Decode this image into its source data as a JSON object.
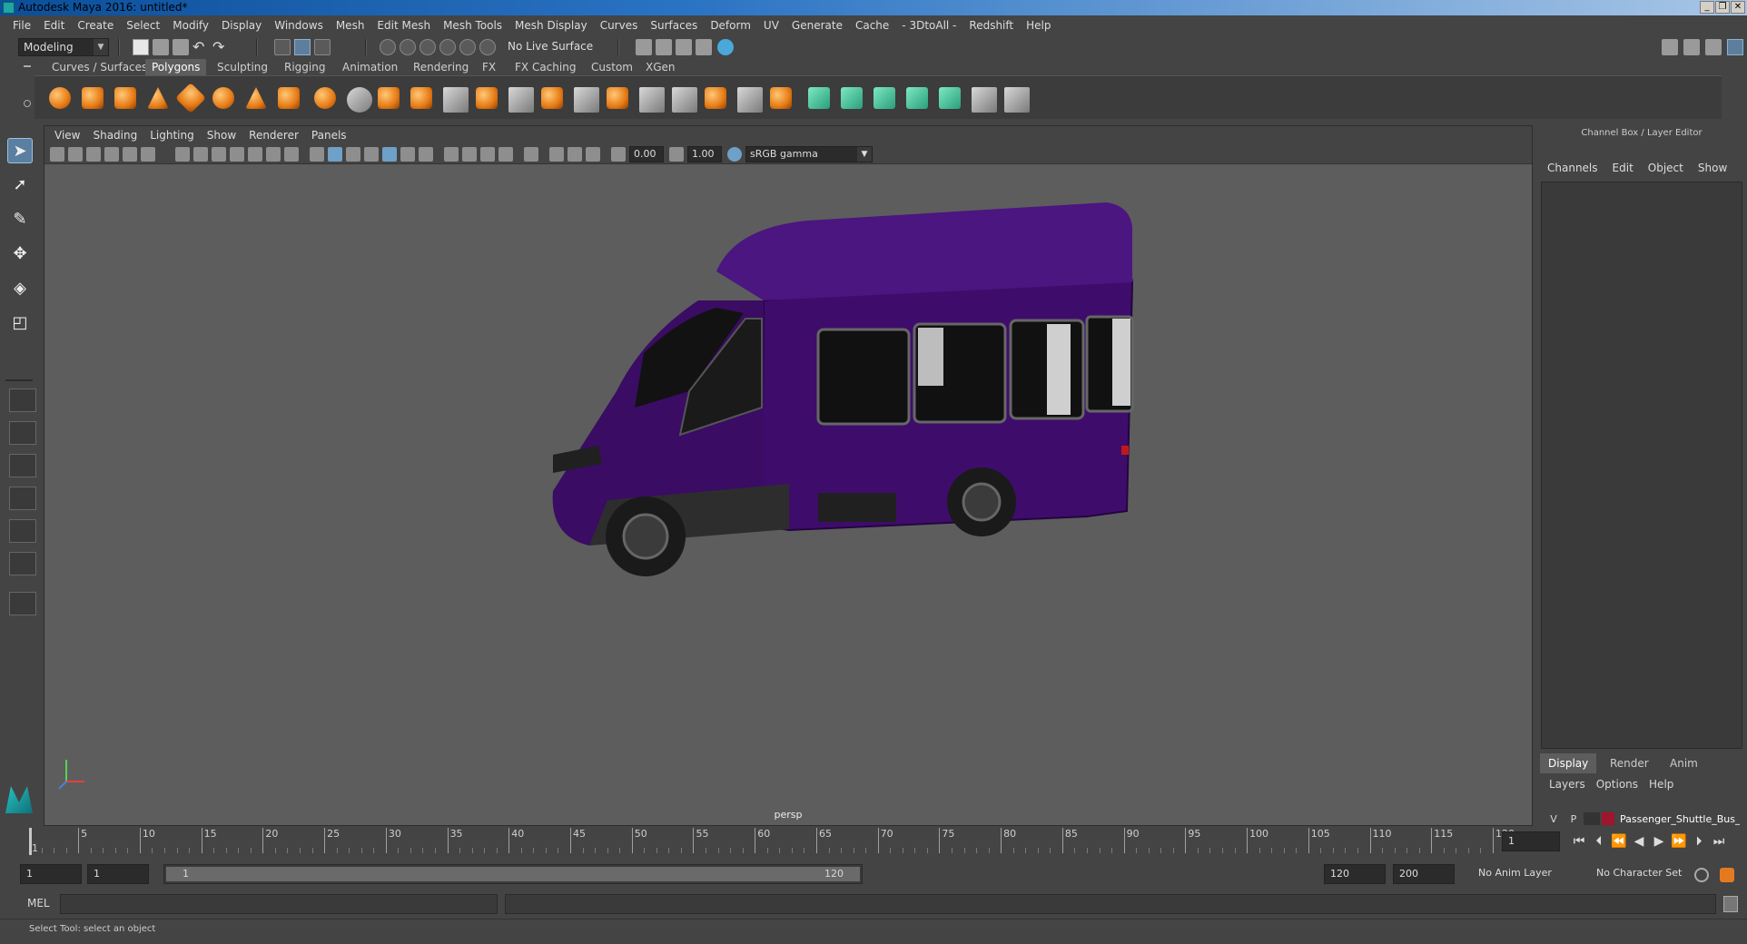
{
  "window": {
    "title": "Autodesk Maya 2016: untitled*"
  },
  "menubar": [
    "File",
    "Edit",
    "Create",
    "Select",
    "Modify",
    "Display",
    "Windows",
    "Mesh",
    "Edit Mesh",
    "Mesh Tools",
    "Mesh Display",
    "Curves",
    "Surfaces",
    "Deform",
    "UV",
    "Generate",
    "Cache",
    "- 3DtoAll -",
    "Redshift",
    "Help"
  ],
  "statusline": {
    "mode": "Modeling",
    "live_surface": "No Live Surface"
  },
  "shelf_tabs": [
    "Curves / Surfaces",
    "Polygons",
    "Sculpting",
    "Rigging",
    "Animation",
    "Rendering",
    "FX",
    "FX Caching",
    "Custom",
    "XGen"
  ],
  "shelf_active": "Polygons",
  "viewport": {
    "menu": [
      "View",
      "Shading",
      "Lighting",
      "Show",
      "Renderer",
      "Panels"
    ],
    "exposure": "0.00",
    "gamma": "1.00",
    "color_space": "sRGB gamma",
    "camera": "persp"
  },
  "channelbox": {
    "title": "Channel Box / Layer Editor",
    "menu": [
      "Channels",
      "Edit",
      "Object",
      "Show"
    ],
    "tabs": [
      "Display",
      "Render",
      "Anim"
    ],
    "layer_menu": [
      "Layers",
      "Options",
      "Help"
    ],
    "layer": {
      "v": "V",
      "p": "P",
      "name": "Passenger_Shuttle_Bus_",
      "color": "#a0142c"
    }
  },
  "timeline": {
    "labels": [
      "1",
      "5",
      "10",
      "15",
      "20",
      "25",
      "30",
      "35",
      "40",
      "45",
      "50",
      "55",
      "60",
      "65",
      "70",
      "75",
      "80",
      "85",
      "90",
      "95",
      "100",
      "105",
      "110",
      "115",
      "120"
    ],
    "current_frame": "1"
  },
  "range": {
    "start": "1",
    "playback_start": "1",
    "slider_start": "1",
    "slider_end": "120",
    "playback_end": "120",
    "end": "200",
    "anim_layer": "No Anim Layer",
    "char_set": "No Character Set"
  },
  "cmd": {
    "lang": "MEL"
  },
  "help": {
    "text": "Select Tool: select an object"
  },
  "colors": {
    "bus": "#3e0d6b",
    "accent": "#5b7fa0"
  }
}
